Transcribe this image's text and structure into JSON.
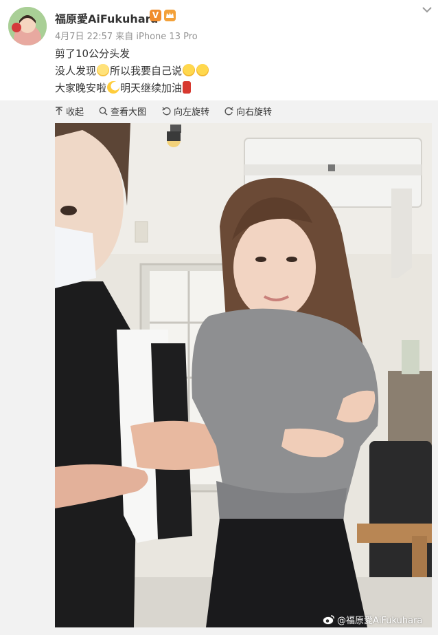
{
  "user": {
    "name": "福原愛AiFukuhara",
    "meta": "4月7日 22:57 来自 iPhone 13 Pro",
    "verified_badge": "V"
  },
  "post": {
    "line1": "剪了10公分头发",
    "line2_a": "没人发现",
    "line2_b": "所以我要自己说",
    "line3_a": "大家晚安啦",
    "line3_b": "明天继续加油"
  },
  "toolbar": {
    "collapse": "收起",
    "view_large": "查看大图",
    "rotate_left": "向左旋转",
    "rotate_right": "向右旋转"
  },
  "watermark": {
    "text": "@福原愛AiFukuhara"
  },
  "colors": {
    "accent": "#f08c2c",
    "meta_text": "#939393",
    "toolbar_bg": "#f2f2f2"
  },
  "icons": [
    "chevron-down-icon",
    "verified-icon",
    "crown-icon",
    "collapse-icon",
    "magnify-icon",
    "rotate-left-icon",
    "rotate-right-icon",
    "weibo-icon"
  ]
}
